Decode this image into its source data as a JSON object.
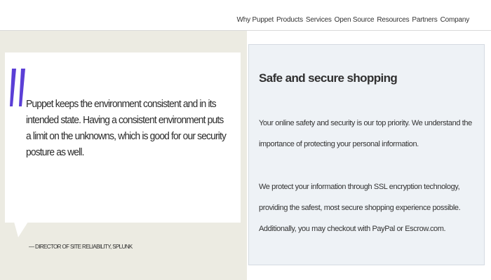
{
  "nav": {
    "items": [
      "Why Puppet",
      "Products",
      "Services",
      "Open Source",
      "Resources",
      "Partners",
      "Company"
    ]
  },
  "quote": {
    "text": "Puppet keeps the environment consistent and in its intended state. Having a consistent environment puts a limit on the unknowns, which is good for our security posture as well.",
    "attribution": "— DIRECTOR OF SITE RELIABILITY, SPLUNK",
    "mark_icon": "quote-icon",
    "mark_color": "#5b3fd6"
  },
  "secure": {
    "title": "Safe and secure shopping",
    "paragraph1": "Your online safety and security is our top priority. We understand the importance of protecting your personal information.",
    "paragraph2": "We protect your information through SSL encryption technology, providing the safest, most secure shopping experience possible. Additionally, you may checkout with PayPal or Escrow.com."
  },
  "colors": {
    "left_bg": "#ecebe2",
    "right_bg": "#eef2f6",
    "accent": "#5b3fd6"
  }
}
